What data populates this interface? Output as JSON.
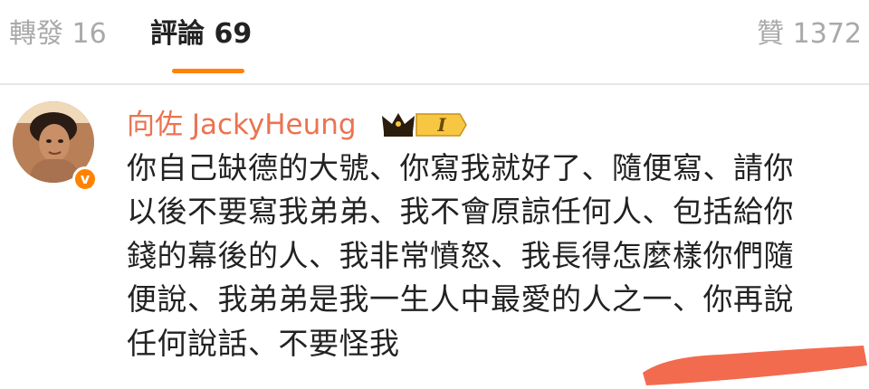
{
  "tabs": {
    "repost": "轉發 16",
    "comments": "評論 69",
    "likes": "贊 1372",
    "active": "comments"
  },
  "comment": {
    "author": "向佐 JackyHeung",
    "badge_level": "I",
    "verified_mark": "v",
    "lines": [
      "你自己缺德的大號、你寫我就好了、隨便寫、請你",
      "以後不要寫我弟弟、我不會原諒任何人、包括給你",
      "錢的幕後的人、我非常憤怒、我長得怎麼樣你們隨",
      "便說、我弟弟是我一生人中最愛的人之一、你再說",
      "任何說話、不要怪我"
    ]
  },
  "colors": {
    "accent": "#ff8200",
    "author_name": "#eb7350",
    "inactive_tab": "#a9a9a9",
    "text": "#222222",
    "redaction": "#f26b4f"
  }
}
